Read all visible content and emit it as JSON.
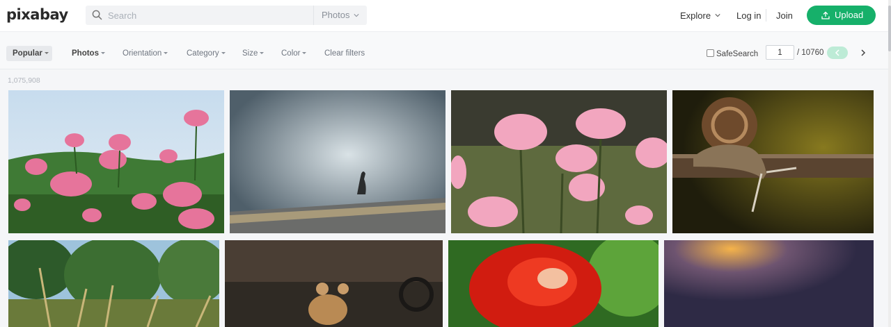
{
  "header": {
    "logo": "pixabay",
    "search": {
      "placeholder": "Search",
      "type": "Photos"
    },
    "nav": {
      "explore": "Explore",
      "login": "Log in",
      "join": "Join"
    },
    "upload": "Upload"
  },
  "filters": {
    "sort": "Popular",
    "media": "Photos",
    "orientation": "Orientation",
    "category": "Category",
    "size": "Size",
    "color": "Color",
    "clear": "Clear filters",
    "safesearch": "SafeSearch",
    "page": "1",
    "total_pages": "/ 10760"
  },
  "results_count": "1,075,908",
  "colors": {
    "accent": "#16b06a",
    "accent_light": "#bdebd6"
  },
  "icons": [
    "search-icon",
    "chevron-down-icon",
    "upload-icon",
    "chevron-left-icon",
    "chevron-right-icon"
  ]
}
